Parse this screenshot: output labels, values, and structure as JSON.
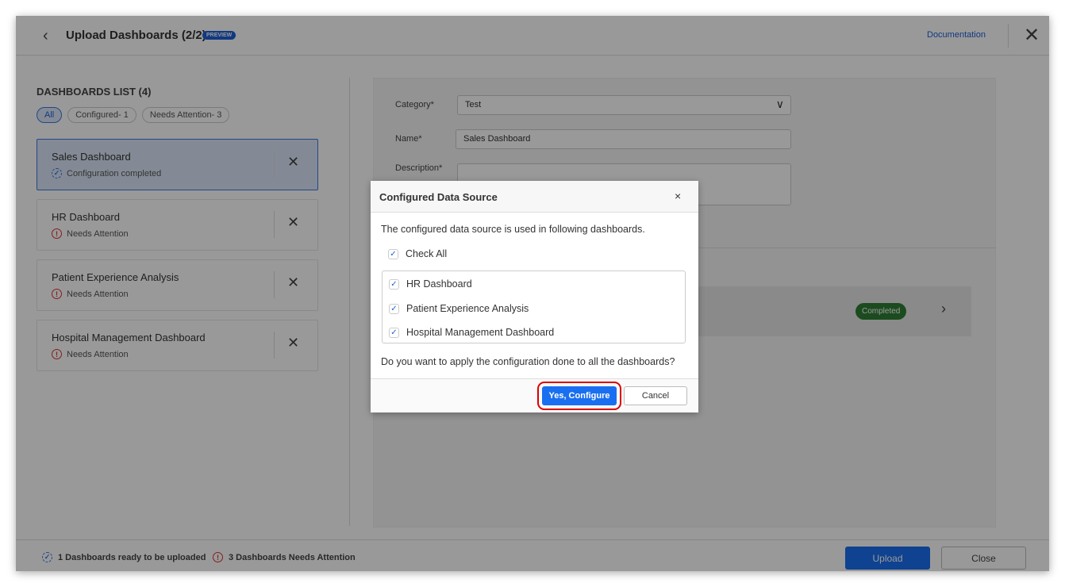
{
  "header": {
    "title": "Upload Dashboards (2/2)",
    "badge": "PREVIEW",
    "documentation": "Documentation"
  },
  "list": {
    "title": "DASHBOARDS LIST (4)",
    "filters": [
      "All",
      "Configured- 1",
      "Needs Attention- 3"
    ],
    "items": [
      {
        "name": "Sales Dashboard",
        "status": "Configuration completed",
        "state": "ok"
      },
      {
        "name": "HR Dashboard",
        "status": "Needs Attention",
        "state": "warn"
      },
      {
        "name": "Patient Experience Analysis",
        "status": "Needs Attention",
        "state": "warn"
      },
      {
        "name": "Hospital Management Dashboard",
        "status": "Needs Attention",
        "state": "warn"
      }
    ]
  },
  "form": {
    "category_label": "Category*",
    "category_value": "Test",
    "name_label": "Name*",
    "name_value": "Sales Dashboard",
    "description_label": "Description*",
    "description_value": "",
    "row_status": "Completed"
  },
  "footer": {
    "ready": "1 Dashboards ready to be uploaded",
    "attention": "3 Dashboards Needs Attention",
    "upload": "Upload",
    "close": "Close"
  },
  "modal": {
    "title": "Configured Data Source",
    "close": "×",
    "message": "The configured data source is used in following dashboards.",
    "check_all": "Check All",
    "dashboards": [
      "HR Dashboard",
      "Patient Experience Analysis",
      "Hospital Management Dashboard"
    ],
    "question": "Do you want to apply the configuration done to all the dashboards?",
    "yes": "Yes, Configure",
    "cancel": "Cancel"
  },
  "colors": {
    "accent": "#1a6ff0",
    "completed": "#2e7d32",
    "warning": "#dd3333",
    "highlight": "#dd0000"
  }
}
